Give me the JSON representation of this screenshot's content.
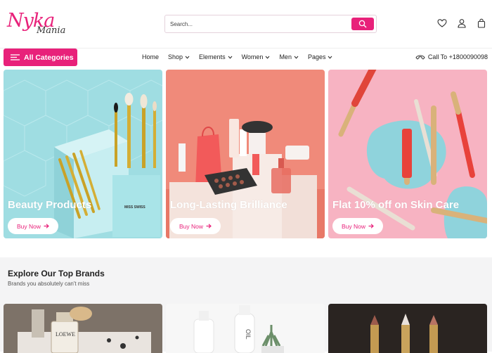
{
  "header": {
    "logo_main": "Nyka",
    "logo_sub": "Mania",
    "search_placeholder": "Search...",
    "icons": [
      "search-icon",
      "heart-icon",
      "user-icon",
      "bag-icon"
    ]
  },
  "nav": {
    "all_categories": "All Categories",
    "items": [
      {
        "label": "Home",
        "dropdown": false
      },
      {
        "label": "Shop",
        "dropdown": true
      },
      {
        "label": "Elements",
        "dropdown": true
      },
      {
        "label": "Women",
        "dropdown": true
      },
      {
        "label": "Men",
        "dropdown": true
      },
      {
        "label": "Pages",
        "dropdown": true
      }
    ],
    "call": "Call To +1800090098"
  },
  "banners": [
    {
      "title": "Beauty Products",
      "button": "Buy Now",
      "bg": "#9fdde2"
    },
    {
      "title": "Long-Lasting Brilliance",
      "button": "Buy Now",
      "bg": "#f08a7a"
    },
    {
      "title": "Flat 10% off on Skin Care",
      "button": "Buy Now",
      "bg": "#f7b3c2"
    }
  ],
  "brands": {
    "title": "Explore Our Top Brands",
    "subtitle": "Brands you absolutely can't miss"
  },
  "colors": {
    "accent": "#e8217a"
  }
}
